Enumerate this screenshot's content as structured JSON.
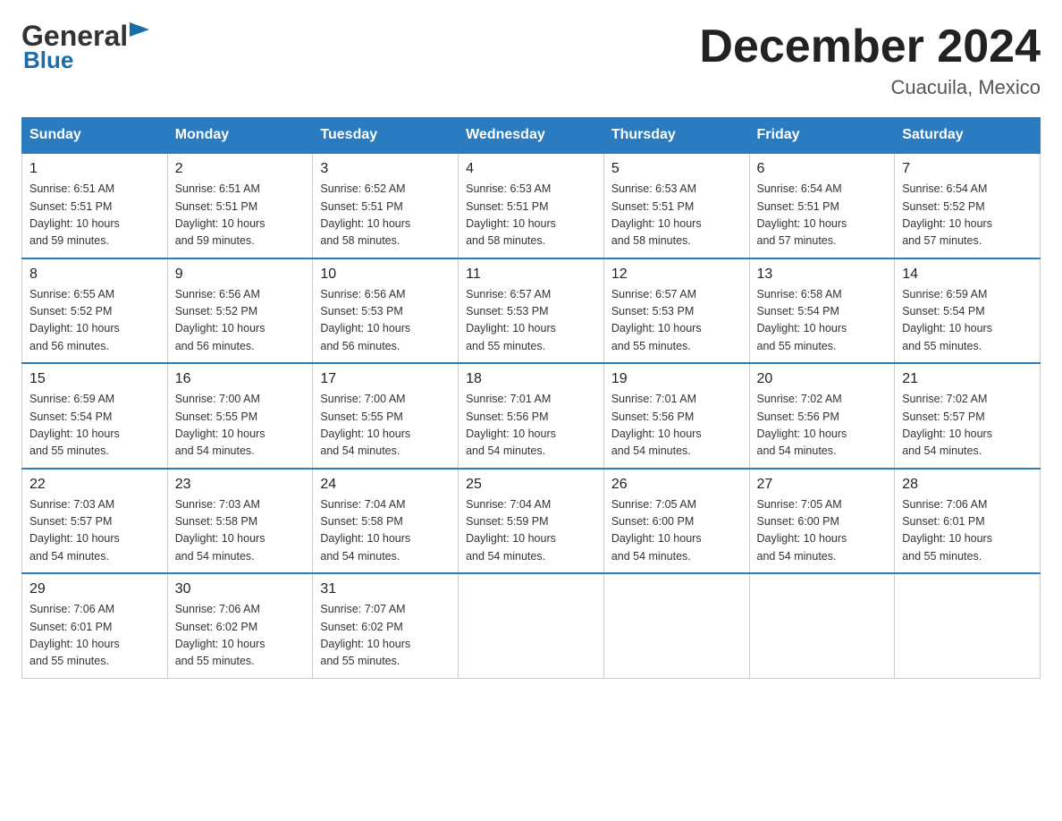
{
  "logo": {
    "general": "General",
    "blue": "Blue",
    "arrow": "▶"
  },
  "title": "December 2024",
  "location": "Cuacuila, Mexico",
  "days_of_week": [
    "Sunday",
    "Monday",
    "Tuesday",
    "Wednesday",
    "Thursday",
    "Friday",
    "Saturday"
  ],
  "weeks": [
    [
      {
        "day": "1",
        "sunrise": "6:51 AM",
        "sunset": "5:51 PM",
        "daylight": "10 hours and 59 minutes."
      },
      {
        "day": "2",
        "sunrise": "6:51 AM",
        "sunset": "5:51 PM",
        "daylight": "10 hours and 59 minutes."
      },
      {
        "day": "3",
        "sunrise": "6:52 AM",
        "sunset": "5:51 PM",
        "daylight": "10 hours and 58 minutes."
      },
      {
        "day": "4",
        "sunrise": "6:53 AM",
        "sunset": "5:51 PM",
        "daylight": "10 hours and 58 minutes."
      },
      {
        "day": "5",
        "sunrise": "6:53 AM",
        "sunset": "5:51 PM",
        "daylight": "10 hours and 58 minutes."
      },
      {
        "day": "6",
        "sunrise": "6:54 AM",
        "sunset": "5:51 PM",
        "daylight": "10 hours and 57 minutes."
      },
      {
        "day": "7",
        "sunrise": "6:54 AM",
        "sunset": "5:52 PM",
        "daylight": "10 hours and 57 minutes."
      }
    ],
    [
      {
        "day": "8",
        "sunrise": "6:55 AM",
        "sunset": "5:52 PM",
        "daylight": "10 hours and 56 minutes."
      },
      {
        "day": "9",
        "sunrise": "6:56 AM",
        "sunset": "5:52 PM",
        "daylight": "10 hours and 56 minutes."
      },
      {
        "day": "10",
        "sunrise": "6:56 AM",
        "sunset": "5:53 PM",
        "daylight": "10 hours and 56 minutes."
      },
      {
        "day": "11",
        "sunrise": "6:57 AM",
        "sunset": "5:53 PM",
        "daylight": "10 hours and 55 minutes."
      },
      {
        "day": "12",
        "sunrise": "6:57 AM",
        "sunset": "5:53 PM",
        "daylight": "10 hours and 55 minutes."
      },
      {
        "day": "13",
        "sunrise": "6:58 AM",
        "sunset": "5:54 PM",
        "daylight": "10 hours and 55 minutes."
      },
      {
        "day": "14",
        "sunrise": "6:59 AM",
        "sunset": "5:54 PM",
        "daylight": "10 hours and 55 minutes."
      }
    ],
    [
      {
        "day": "15",
        "sunrise": "6:59 AM",
        "sunset": "5:54 PM",
        "daylight": "10 hours and 55 minutes."
      },
      {
        "day": "16",
        "sunrise": "7:00 AM",
        "sunset": "5:55 PM",
        "daylight": "10 hours and 54 minutes."
      },
      {
        "day": "17",
        "sunrise": "7:00 AM",
        "sunset": "5:55 PM",
        "daylight": "10 hours and 54 minutes."
      },
      {
        "day": "18",
        "sunrise": "7:01 AM",
        "sunset": "5:56 PM",
        "daylight": "10 hours and 54 minutes."
      },
      {
        "day": "19",
        "sunrise": "7:01 AM",
        "sunset": "5:56 PM",
        "daylight": "10 hours and 54 minutes."
      },
      {
        "day": "20",
        "sunrise": "7:02 AM",
        "sunset": "5:56 PM",
        "daylight": "10 hours and 54 minutes."
      },
      {
        "day": "21",
        "sunrise": "7:02 AM",
        "sunset": "5:57 PM",
        "daylight": "10 hours and 54 minutes."
      }
    ],
    [
      {
        "day": "22",
        "sunrise": "7:03 AM",
        "sunset": "5:57 PM",
        "daylight": "10 hours and 54 minutes."
      },
      {
        "day": "23",
        "sunrise": "7:03 AM",
        "sunset": "5:58 PM",
        "daylight": "10 hours and 54 minutes."
      },
      {
        "day": "24",
        "sunrise": "7:04 AM",
        "sunset": "5:58 PM",
        "daylight": "10 hours and 54 minutes."
      },
      {
        "day": "25",
        "sunrise": "7:04 AM",
        "sunset": "5:59 PM",
        "daylight": "10 hours and 54 minutes."
      },
      {
        "day": "26",
        "sunrise": "7:05 AM",
        "sunset": "6:00 PM",
        "daylight": "10 hours and 54 minutes."
      },
      {
        "day": "27",
        "sunrise": "7:05 AM",
        "sunset": "6:00 PM",
        "daylight": "10 hours and 54 minutes."
      },
      {
        "day": "28",
        "sunrise": "7:06 AM",
        "sunset": "6:01 PM",
        "daylight": "10 hours and 55 minutes."
      }
    ],
    [
      {
        "day": "29",
        "sunrise": "7:06 AM",
        "sunset": "6:01 PM",
        "daylight": "10 hours and 55 minutes."
      },
      {
        "day": "30",
        "sunrise": "7:06 AM",
        "sunset": "6:02 PM",
        "daylight": "10 hours and 55 minutes."
      },
      {
        "day": "31",
        "sunrise": "7:07 AM",
        "sunset": "6:02 PM",
        "daylight": "10 hours and 55 minutes."
      },
      null,
      null,
      null,
      null
    ]
  ]
}
